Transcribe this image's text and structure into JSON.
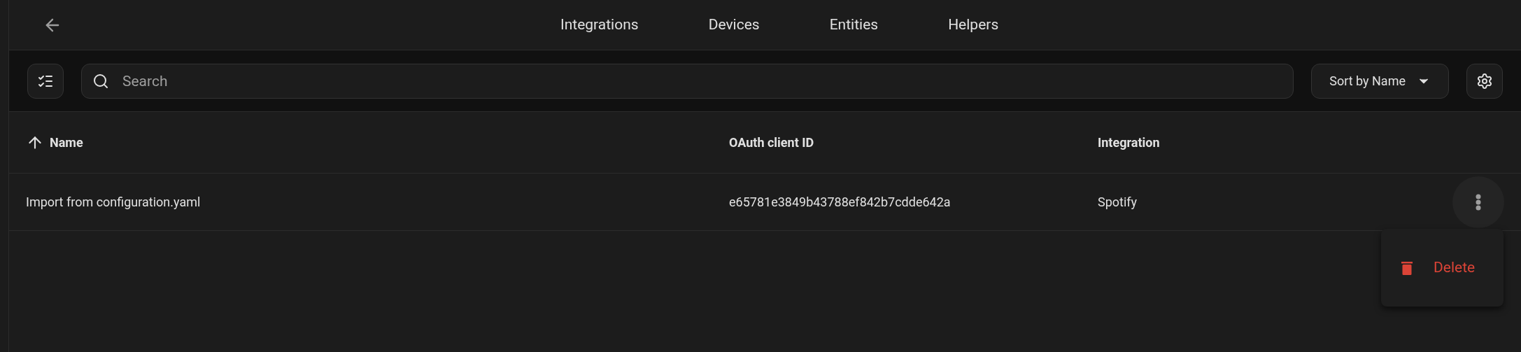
{
  "tabs": [
    {
      "label": "Integrations"
    },
    {
      "label": "Devices"
    },
    {
      "label": "Entities"
    },
    {
      "label": "Helpers"
    }
  ],
  "search": {
    "placeholder": "Search"
  },
  "sort": {
    "label": "Sort by Name"
  },
  "table": {
    "columns": [
      {
        "label": "Name",
        "sorted": true
      },
      {
        "label": "OAuth client ID",
        "sorted": false
      },
      {
        "label": "Integration",
        "sorted": false
      }
    ],
    "rows": [
      {
        "cells": [
          "Import from configuration.yaml",
          "e65781e3849b43788ef842b7cdde642a",
          "Spotify"
        ]
      }
    ]
  },
  "menu": {
    "items": [
      {
        "label": "Delete",
        "kind": "danger"
      }
    ]
  }
}
